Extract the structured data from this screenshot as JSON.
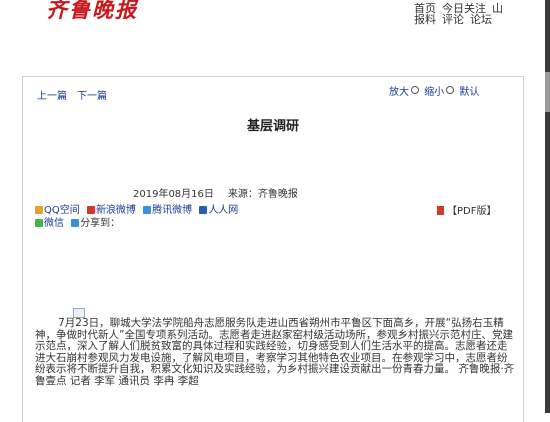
{
  "header": {
    "logo": "齐鲁晚报",
    "nav_row1": [
      "首页",
      "今日关注",
      "山"
    ],
    "nav_row2": [
      "报料",
      "评论",
      "论坛"
    ]
  },
  "article": {
    "pager": {
      "prev": "上一篇",
      "next": "下一篇"
    },
    "zoom": {
      "enlarge": "放大",
      "shrink": "缩小",
      "default": "默认"
    },
    "title": "基层调研",
    "date": "2019年08月16日",
    "source": "来源：齐鲁晚报",
    "share": {
      "items": [
        {
          "label": "QQ空间",
          "color": "#e8a02c",
          "icon": "qzone-icon"
        },
        {
          "label": "新浪微博",
          "color": "#d9362f",
          "icon": "weibo-icon"
        },
        {
          "label": "腾讯微博",
          "color": "#3a8fd6",
          "icon": "tencent-weibo-icon"
        },
        {
          "label": "人人网",
          "color": "#2a5db0",
          "icon": "renren-icon"
        },
        {
          "label": "微信",
          "color": "#44b549",
          "icon": "wechat-icon"
        },
        {
          "label": "分享到：",
          "color": "#3a8fd6",
          "icon": "share-icon"
        }
      ]
    },
    "pdf": {
      "label": "【PDF版】",
      "icon": "pdf-icon"
    },
    "body": "7月23日，聊城大学法学院船舟志愿服务队走进山西省朔州市平鲁区下面高乡，开展“弘扬右玉精神，争做时代新人”全国专项系列活动。志愿者走进赵家窑村级活动场所，参观乡村振兴示范村庄、党建示范点，深入了解人们脱贫致富的具体过程和实践经验，切身感受到人们生活水平的提高。志愿者还走进大石崩村参观风力发电设施，了解风电项目，考察学习其他特色农业项目。在参观学习中，志愿者纷纷表示将不断提升自我，积累文化知识及实践经验，为乡村振兴建设贡献出一份青春力量。    齐鲁晚报·齐鲁壹点  记者  李军  通讯员  李冉  李超"
  }
}
